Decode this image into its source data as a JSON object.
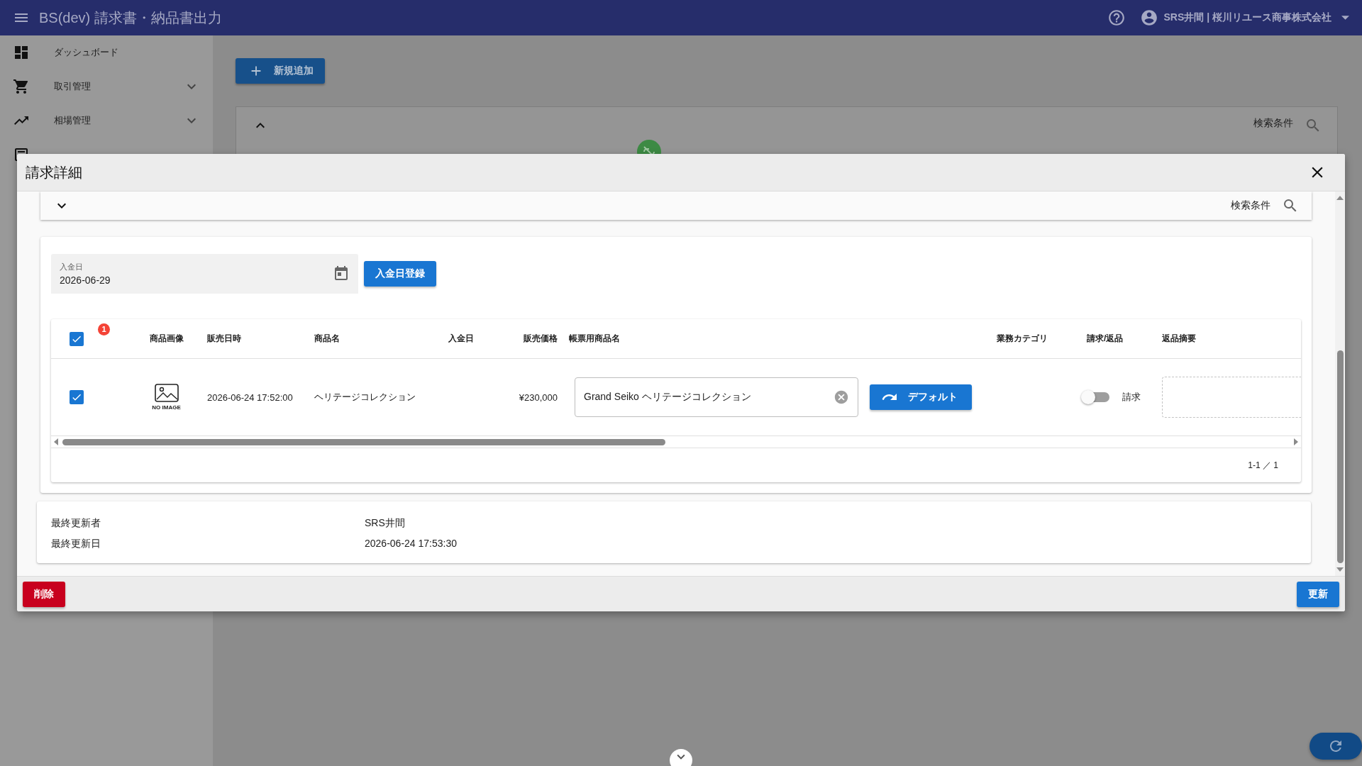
{
  "app_bar": {
    "title": "BS(dev) 請求書・納品書出力",
    "user": "SRS井間 | 桜川リユース商事株式会社"
  },
  "sidebar": {
    "items": [
      {
        "label": "ダッシュボード",
        "kind": "dashboard"
      },
      {
        "label": "取引管理",
        "kind": "cart",
        "expanded": false
      },
      {
        "label": "相場管理",
        "kind": "trend",
        "expanded": false
      },
      {
        "kind": "sheet"
      }
    ]
  },
  "page": {
    "add_button": "新規追加",
    "search_panel": {
      "label": "検索条件",
      "expanded": true
    }
  },
  "dialog": {
    "title": "請求詳細",
    "search_panel": {
      "label": "検索条件",
      "expanded": false
    },
    "payment_date": {
      "label": "入金日",
      "value": "2026-06-29"
    },
    "register_button": "入金日登録",
    "table": {
      "select_all": {
        "checked": true,
        "badge": "1"
      },
      "columns": [
        "商品画像",
        "販売日時",
        "商品名",
        "入金日",
        "販売価格",
        "帳票用商品名",
        "業務カテゴリ",
        "請求/返品",
        "返品摘要"
      ],
      "rows": [
        {
          "checked": true,
          "image": "NO IMAGE",
          "sold_at": "2026-06-24 17:52:00",
          "name": "ヘリテージコレクション",
          "price": "¥230,000",
          "slip_name": "Grand Seiko ヘリテージコレクション",
          "default_button": "デフォルト",
          "return": false,
          "return_label": "請求"
        }
      ],
      "pagination": "1-1 ／ 1"
    },
    "info": [
      {
        "label": "最終更新者",
        "value": "SRS井間"
      },
      {
        "label": "最終更新日",
        "value": "2026-06-24 17:53:30"
      }
    ],
    "delete_button": "削除",
    "update_button": "更新"
  }
}
